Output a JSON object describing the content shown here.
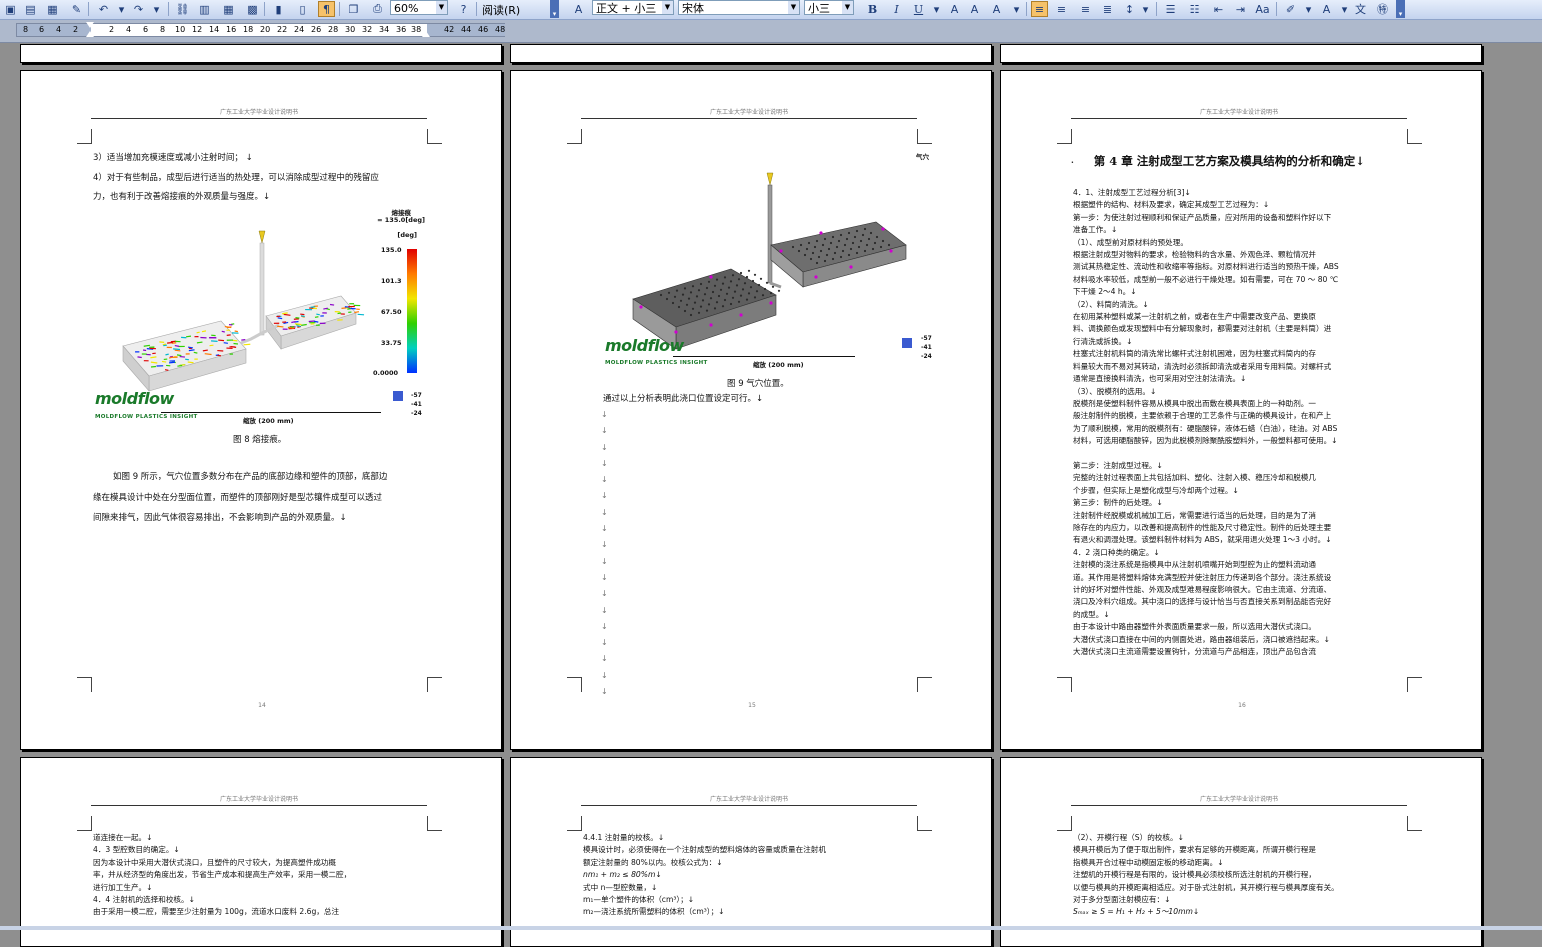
{
  "toolbar": {
    "zoom": "60%",
    "view_mode": "阅读(R)",
    "style": "正文 + 小三",
    "font": "宋体",
    "size": "小三",
    "bold": "B",
    "italic": "I",
    "underline": "U"
  },
  "ruler": {
    "left_numbers": [
      "8",
      "6",
      "4",
      "2"
    ],
    "right_numbers": [
      "2",
      "4",
      "6",
      "8",
      "10",
      "12",
      "14",
      "16",
      "18",
      "20",
      "22",
      "24",
      "26",
      "28",
      "30",
      "32",
      "34",
      "36",
      "38"
    ],
    "margin_numbers": [
      "42",
      "44",
      "46",
      "48"
    ]
  },
  "page_header": "广东工业大学毕业设计说明书",
  "pages": {
    "p14": {
      "number": "14",
      "lines": [
        "3）适当增加充模速度或减小注射时间； ↓",
        "4）对于有些制品，成型后进行适当的热处理，可以消除成型过程中的残留应",
        "力，也有利于改善熔接痕的外观质量与强度。↓"
      ],
      "legend_title": "熔接痕",
      "legend_subtitle": "= 135.0[deg]",
      "legend_unit": "[deg]",
      "legend_ticks": [
        "135.0",
        "101.3",
        "67.50",
        "33.75",
        "0.0000"
      ],
      "scale_label": "缩放 (200 mm)",
      "axis_tags": [
        "-57",
        "-41",
        "-24"
      ],
      "logo": "moldflow",
      "logo_sub": "MOLDFLOW PLASTICS INSIGHT",
      "caption": "图 8  熔接痕。",
      "para": [
        "如图 9 所示，气穴位置多数分布在产品的底部边缘和塑件的顶部，底部边",
        "缘在模具设计中处在分型面位置，而塑件的顶部刚好是型芯镶件成型可以透过",
        "间隙来排气，因此气体很容易排出，不会影响到产品的外观质量。↓"
      ]
    },
    "p15": {
      "number": "15",
      "corner_label": "气穴",
      "scale_label": "缩放 (200 mm)",
      "axis_tags": [
        "-57",
        "-41",
        "-24"
      ],
      "logo": "moldflow",
      "logo_sub": "MOLDFLOW PLASTICS INSIGHT",
      "caption": "图 9  气穴位置。",
      "conclusion": "通过以上分析表明此浇口位置设定可行。↓"
    },
    "p16": {
      "number": "16",
      "chapter_title": "第 4 章    注射成型工艺方案及模具结构的分析和确定↓",
      "lines": [
        "4．1、注射成型工艺过程分析[3]↓",
        "      根据塑件的结构、材料及要求，确定其成型工艺过程为：↓",
        "第一步：为使注射过程顺利和保证产品质量，应对所用的设备和塑料作好以下",
        "准备工作。↓",
        "（1）、成型前对原材料的预处理。",
        "      根据注射成型对物料的要求，检验物料的含水量、外观色泽、颗粒情况并",
        "测试其热稳定性、流动性和收缩率等指标。对原材料进行适当的预热干燥，ABS",
        "材料吸水率较低，成型前一般不必进行干燥处理。如有需要，可在 70 ～ 80 ℃",
        "下干燥 2～4 h。↓",
        "（2）、料筒的清洗。↓",
        "      在初用某种塑料或某一注射机之前，或者在生产中需要改变产品、更换原",
        "料、调换颜色或发现塑料中有分解现象时，都需要对注射机（主要是料筒）进",
        "行清洗或拆换。↓",
        "      柱塞式注射机料筒的清洗常比螺杆式注射机困难，因为柱塞式料筒内的存",
        "料量较大而不易对其转动，清洗时必须拆卸清洗或者采用专用料筒。对螺杆式",
        "通常是直接换料清洗，也可采用对空注射法清洗。↓",
        "（3）、脱模剂的选用。↓",
        "      脱模剂是使塑料制件容易从模具中脱出而敷在模具表面上的一种助剂。一",
        "般注射制件的脱模，主要依赖于合理的工艺条件与正确的模具设计，在和产上",
        "为了顺利脱模，常用的脱模剂有：硬脂酸锌，液体石蜡（白油），硅油。对 ABS",
        "材料，可选用硬脂酸锌，因为此脱模剂除聚酰胺塑料外，一般塑料都可使用。↓",
        "",
        "第二步：注射成型过程。↓",
        "      完整的注射过程表面上共包括加料、塑化、注射入模、稳压冷却和脱模几",
        "个步骤，但实际上是塑化成型与冷却两个过程。↓",
        "第三步：制件的后处理。↓",
        "      注射制件经脱模或机械加工后，常需要进行适当的后处理，目的是为了消",
        "除存在的内应力，以改善和提高制件的性能及尺寸稳定性。制件的后处理主要",
        "有退火和调湿处理。该塑料制件材料为 ABS，就采用退火处理 1～3 小时。↓",
        "4．2    浇口种类的确定。↓",
        "      注射模的浇注系统是指模具中从注射机喷嘴开始到型腔为止的塑料流动通",
        "道。其作用是将塑料熔体充满型腔并使注射压力传递到各个部分。浇注系统设",
        "计的好坏对塑件性能、外观及成型难易程度影响很大。它由主流道、分流道、",
        "浇口及冷料穴组成。其中浇口的选择与设计恰当与否直接关系到制品能否完好",
        "的成型。↓",
        "      由于本设计中路由器塑件外表面质量要求一般，所以选用大潜伏式浇口。",
        "大潜伏式浇口直接在中间的内侧面处进，路由器组装后，浇口被遮挡起来。↓",
        "      大潜伏式浇口主流道需要设置钩针，分流道与产品相连，顶出产品包含流"
      ]
    },
    "p17": {
      "lines": [
        "道连接在一起。↓",
        "4．3    型腔数目的确定。↓",
        "      因为本设计中采用大潜伏式浇口，且塑件的尺寸较大，为提高塑件成功概",
        "率，并从经济型的角度出发，节省生产成本和提高生产效率，采用一模二腔，",
        "进行加工生产。↓",
        "4．4    注射机的选择和校核。↓",
        "      由于采用一模二腔，需要至少注射量为 100g，流道水口废料 2.6g，总注"
      ]
    },
    "p18": {
      "lines": [
        "4.4.1   注射量的校核。↓",
        "      模具设计时，必须使得在一个注射成型的塑料熔体的容量或质量在注射机",
        "额定注射量的 80%以内。校核公式为：↓",
        "                              nm₁ + m₂ ≤ 80%m↓",
        "      式中               n—型腔数量，↓",
        "                              m₁—单个塑件的体积（cm³）；↓",
        "                              m₂—浇注系统所需塑料的体积（cm³）；↓"
      ]
    },
    "p19": {
      "lines": [
        "（2）、开模行程（S）的校核。↓",
        "      模具开模后为了便于取出制件，要求有足够的开模距离，所谓开模行程是",
        "指模具开合过程中动模固定板的移动距离。↓",
        "      注塑机的开模行程是有限的，设计模具必须校核所选注射机的开模行程，",
        "以便与模具的开模距离相适应。对于卧式注射机，其开模行程与模具厚度有关。",
        "对于多分型面注射模应有：↓",
        "                              Sₘₐₓ ≥ S = H₁ + H₂ + 5～10mm↓"
      ]
    }
  },
  "colors": {
    "background": "#8f8f8f",
    "toolbar": "#d6e2f7",
    "moldflow_green": "#1a7a2a",
    "page": "#ffffff"
  }
}
